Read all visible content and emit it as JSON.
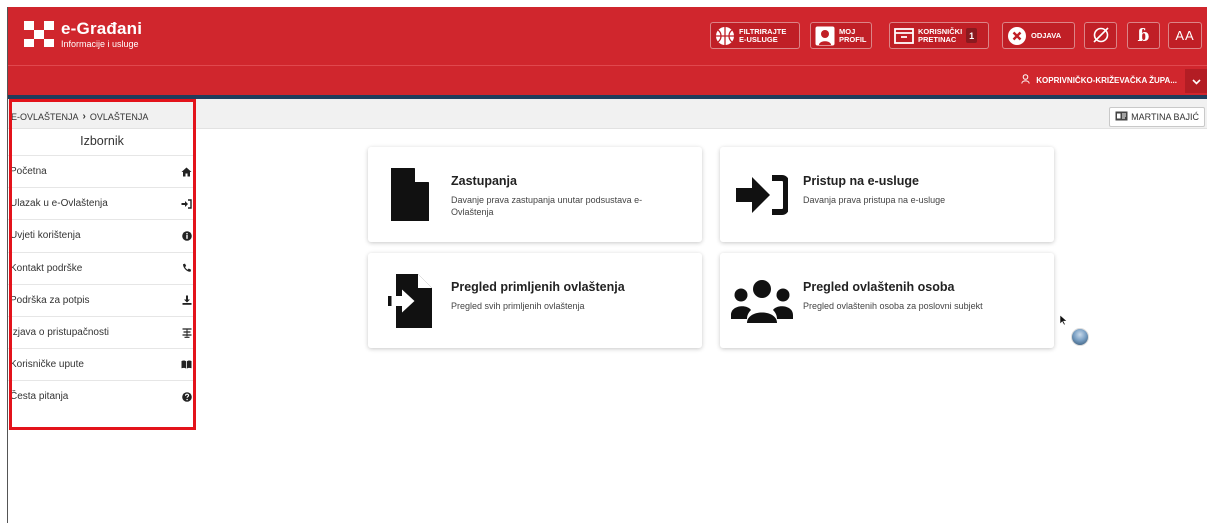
{
  "brand": {
    "title": "e-Građani",
    "subtitle": "Informacije i usluge"
  },
  "toolbar": {
    "filter_label": "FILTRIRAJTE\nE-USLUGE",
    "profile_label": "MOJ\nPROFIL",
    "inbox_label": "KORISNIČKI\nPRETINAC",
    "inbox_count": "1",
    "logout_label": "ODJAVA",
    "font_label": "AA"
  },
  "org": {
    "name": "KOPRIVNIČKO-KRIŽEVAČKA ŽUPA..."
  },
  "breadcrumb": {
    "root": "E-OVLAŠTENJA",
    "current": "OVLAŠTENJA"
  },
  "user": {
    "name": "MARTINA BAJIĆ"
  },
  "sidebar": {
    "title": "Izbornik",
    "items": [
      {
        "label": "Početna",
        "icon": "home-icon"
      },
      {
        "label": "Ulazak u e-Ovlaštenja",
        "icon": "sign-in-icon"
      },
      {
        "label": "Uvjeti korištenja",
        "icon": "info-icon"
      },
      {
        "label": "Kontakt podrške",
        "icon": "phone-icon"
      },
      {
        "label": "Podrška za potpis",
        "icon": "download-icon"
      },
      {
        "label": "Izjava o pristupačnosti",
        "icon": "accessibility-icon"
      },
      {
        "label": "Korisničke upute",
        "icon": "book-icon"
      },
      {
        "label": "Česta pitanja",
        "icon": "question-icon"
      }
    ]
  },
  "cards": [
    {
      "title": "Zastupanja",
      "desc": "Davanje prava zastupanja unutar podsustava e-Ovlaštenja",
      "icon": "document-icon"
    },
    {
      "title": "Pristup na e-usluge",
      "desc": "Davanja prava pristupa na e-usluge",
      "icon": "sign-in-icon"
    },
    {
      "title": "Pregled primljenih ovlaštenja",
      "desc": "Pregled svih primljenih ovlaštenja",
      "icon": "file-import-icon"
    },
    {
      "title": "Pregled ovlaštenih osoba",
      "desc": "Pregled ovlaštenih osoba za poslovni subjekt",
      "icon": "users-icon"
    }
  ],
  "colors": {
    "brand_red": "#d0262d",
    "accent_navy": "#1f3d5c",
    "highlight": "#e3131b"
  }
}
